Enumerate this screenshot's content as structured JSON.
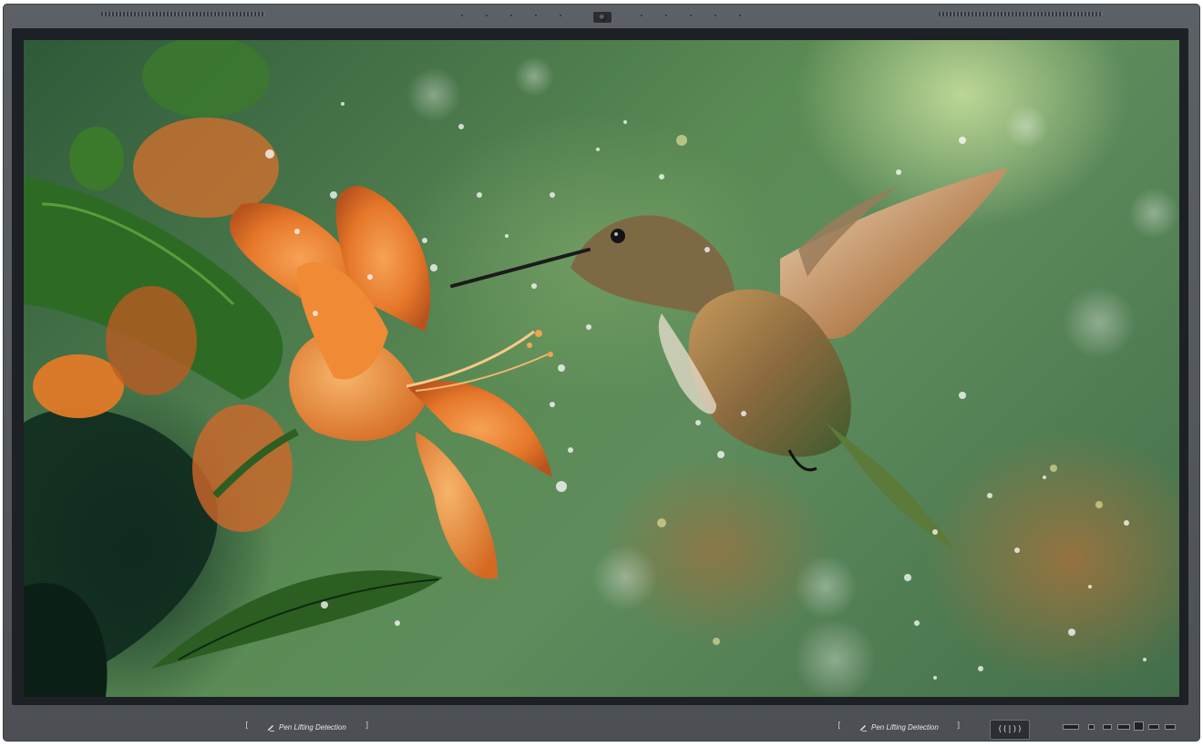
{
  "device": {
    "pen_buttons": [
      {
        "label": "Pen Lifting Detection"
      },
      {
        "label": "Pen Lifting Detection"
      }
    ],
    "nfc_label": "((|))"
  },
  "colors": {
    "frame": "#54585d",
    "bezel": "#1d2024",
    "petal_orange": "#e6782a",
    "leaf_green": "#2f6b2c"
  },
  "icons": [
    "pen-icon",
    "nfc-icon",
    "camera-icon",
    "speaker-grille"
  ]
}
